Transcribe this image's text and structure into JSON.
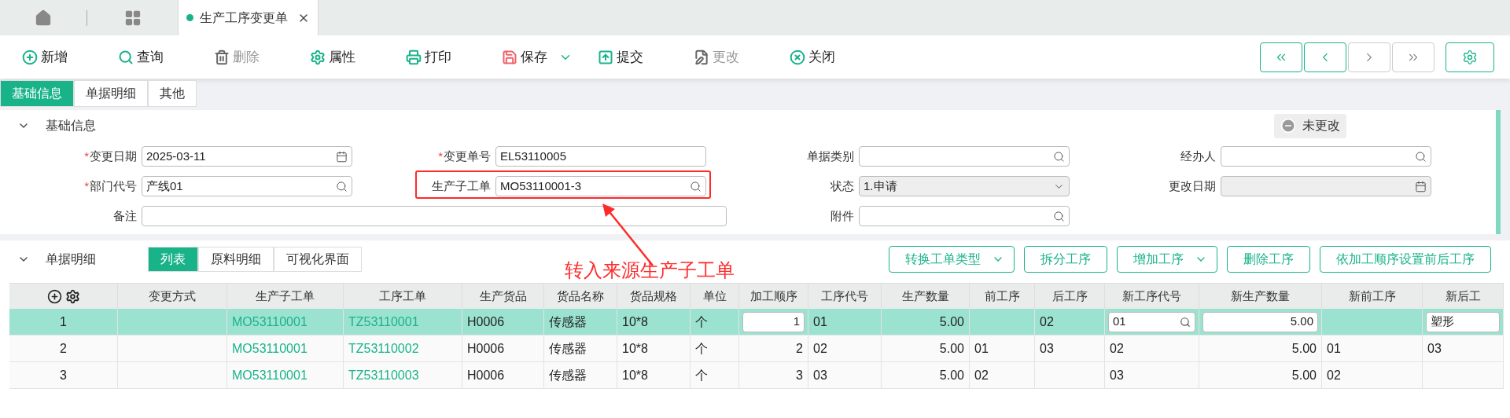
{
  "tabs": [
    {
      "label": "生产工序变更单",
      "selected": true
    }
  ],
  "toolbar": [
    {
      "label": "新增",
      "disabled": false
    },
    {
      "label": "查询",
      "disabled": false
    },
    {
      "label": "删除",
      "disabled": true
    },
    {
      "label": "属性",
      "disabled": false
    },
    {
      "label": "打印",
      "disabled": false
    },
    {
      "label": "保存",
      "disabled": false,
      "dropdown": true
    },
    {
      "label": "提交",
      "disabled": false
    },
    {
      "label": "更改",
      "disabled": true
    },
    {
      "label": "关闭",
      "disabled": false
    }
  ],
  "nav_buttons": [
    {
      "disabled": false
    },
    {
      "disabled": false
    },
    {
      "disabled": true
    },
    {
      "disabled": true
    }
  ],
  "page_tabs": [
    {
      "label": "基础信息",
      "selected": true
    },
    {
      "label": "单据明细",
      "selected": false
    },
    {
      "label": "其他",
      "selected": false
    }
  ],
  "basic_section": {
    "title": "基础信息",
    "expanded": true,
    "status_badge": "未更改",
    "rows": [
      [
        {
          "marker": "*",
          "label": "变更日期",
          "kind": "date",
          "value": "2025-03-11"
        },
        {
          "marker": "*",
          "label": "变更单号",
          "kind": "text",
          "value": "EL53110005"
        },
        {
          "label": "单据类别",
          "kind": "search"
        },
        {
          "label": "经办人",
          "kind": "search"
        }
      ],
      [
        {
          "marker": "*",
          "label": "部门代号",
          "kind": "search",
          "value": "产线01"
        },
        {
          "label": "生产子工单",
          "kind": "search",
          "value": "MO53110001-3",
          "highlighted": true
        },
        {
          "label": "状态",
          "kind": "select",
          "value": "1.申请"
        },
        {
          "label": "更改日期",
          "kind": "date",
          "disabled": true
        }
      ],
      [
        {
          "label": "备注",
          "kind": "note"
        },
        "",
        {
          "label": "附件",
          "kind": "search"
        }
      ]
    ]
  },
  "annotation": {
    "text": "转入来源生产子工单"
  },
  "detail_section": {
    "title": "单据明细",
    "expanded": true,
    "tabs": [
      {
        "label": "列表",
        "selected": true
      },
      {
        "label": "原料明细",
        "selected": false
      },
      {
        "label": "可视化界面",
        "selected": false
      }
    ],
    "actions": [
      {
        "label": "转换工单类型",
        "dropdown": true
      },
      {
        "label": "拆分工序",
        "dropdown": false
      },
      {
        "label": "增加工序",
        "dropdown": true
      },
      {
        "label": "删除工序",
        "dropdown": false
      },
      {
        "label": "依加工顺序设置前后工序",
        "dropdown": false
      }
    ]
  },
  "table": {
    "columns": [
      {
        "kind": "index"
      },
      {
        "label": "变更方式",
        "kind": "text"
      },
      {
        "label": "生产子工单",
        "kind": "link"
      },
      {
        "label": "工序工单",
        "kind": "link"
      },
      {
        "label": "生产货品",
        "kind": "text"
      },
      {
        "label": "货品名称",
        "kind": "text"
      },
      {
        "label": "货品规格",
        "kind": "text"
      },
      {
        "label": "单位",
        "kind": "text"
      },
      {
        "label": "加工顺序",
        "kind": "number"
      },
      {
        "label": "工序代号",
        "kind": "text"
      },
      {
        "label": "生产数量",
        "kind": "number"
      },
      {
        "label": "前工序",
        "kind": "text"
      },
      {
        "label": "后工序",
        "kind": "text"
      },
      {
        "label": "新工序代号",
        "kind": "text"
      },
      {
        "label": "新生产数量",
        "kind": "number"
      },
      {
        "label": "新前工序",
        "kind": "text"
      },
      {
        "label": "新后工",
        "kind": "text"
      }
    ],
    "rows": [
      {
        "selected": true,
        "cells": [
          "1",
          null,
          "MO53110001",
          "TZ53110001",
          "H0006",
          "传感器",
          "10*8",
          "个",
          {
            "kind": "input",
            "value": "1"
          },
          "01",
          "5.00",
          null,
          "02",
          {
            "kind": "search-input",
            "value": "01"
          },
          {
            "kind": "input",
            "value": "5.00"
          },
          null,
          {
            "kind": "input",
            "value": "塑形"
          }
        ]
      },
      {
        "selected": false,
        "cells": [
          "2",
          null,
          "MO53110001",
          "TZ53110002",
          "H0006",
          "传感器",
          "10*8",
          "个",
          "2",
          "02",
          "5.00",
          "01",
          "03",
          "02",
          "5.00",
          "01",
          "03"
        ]
      },
      {
        "selected": false,
        "cells": [
          "3",
          null,
          "MO53110001",
          "TZ53110003",
          "H0006",
          "传感器",
          "10*8",
          "个",
          "3",
          "03",
          "5.00",
          "02",
          null,
          "03",
          "5.00",
          "02",
          null
        ]
      }
    ]
  }
}
